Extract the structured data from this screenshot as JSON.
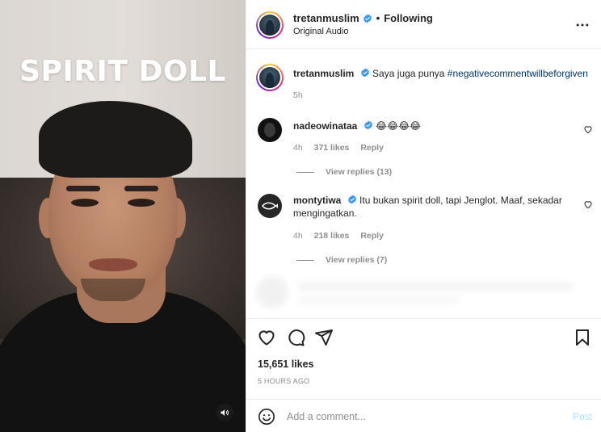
{
  "video": {
    "overlay_text": "SPIRIT DOLL",
    "sound_icon": "speaker-icon"
  },
  "header": {
    "username": "tretanmuslim",
    "follow_status": "Following",
    "separator": "•",
    "subtitle": "Original Audio",
    "more_icon": "more-horizontal-icon"
  },
  "caption": {
    "username": "tretanmuslim",
    "text": "Saya juga punya",
    "hashtag": "#negativecommentwillbeforgiven",
    "time": "5h"
  },
  "comments": [
    {
      "username": "nadeowinataa",
      "text": "😂😂😂😂",
      "time": "4h",
      "likes": "371 likes",
      "reply": "Reply",
      "view_replies": "View replies (13)"
    },
    {
      "username": "montytiwa",
      "text": "Itu bukan spirit doll, tapi Jenglot. Maaf, sekadar mengingatkan.",
      "time": "4h",
      "likes": "218 likes",
      "reply": "Reply",
      "view_replies": "View replies (7)"
    }
  ],
  "actions": {
    "like_icon": "heart-icon",
    "comment_icon": "comment-icon",
    "share_icon": "send-icon",
    "save_icon": "bookmark-icon",
    "likes_count": "15,651 likes",
    "time_ago": "5 HOURS AGO"
  },
  "comment_box": {
    "emoji_icon": "emoji-icon",
    "placeholder": "Add a comment...",
    "post_label": "Post"
  },
  "colors": {
    "verified": "#3897f0",
    "hashtag": "#00376b",
    "muted": "#8e8e8e",
    "post_disabled": "#b2dffc"
  }
}
